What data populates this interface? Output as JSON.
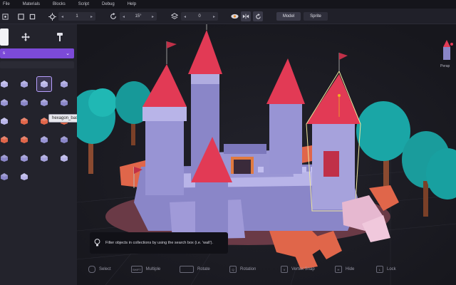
{
  "menu": {
    "items": [
      {
        "label": "File"
      },
      {
        "label": "Materials"
      },
      {
        "label": "Blocks"
      },
      {
        "label": "Script"
      },
      {
        "label": "Debug"
      },
      {
        "label": "Help"
      }
    ]
  },
  "toolbar": {
    "step_value": "1",
    "rotate_value": "15°",
    "layer_value": "0",
    "mode_model": "Model",
    "mode_sprite": "Sprite"
  },
  "sidebar": {
    "collection_label": "s",
    "tooltip": "hexagon_base"
  },
  "hint": {
    "text": "Filter objects in collections by using the search box (i.e. 'wall')."
  },
  "shortcuts": [
    {
      "key": "",
      "label": "Select"
    },
    {
      "key": "SHIFT",
      "label": "Multiple"
    },
    {
      "key": "",
      "label": "Rotate"
    },
    {
      "key": "Q",
      "label": "Rotation"
    },
    {
      "key": "V",
      "label": "Vertex Snap"
    },
    {
      "key": "H",
      "label": "Hide"
    },
    {
      "key": "L",
      "label": "Lock"
    }
  ],
  "preview": {
    "label": "Perap"
  },
  "colors": {
    "accent": "#7c4ad8",
    "mode_active": "#3a3a48",
    "mode_inactive": "#2e2e3a",
    "roof_red": "#e23a55",
    "castle_wall": "#8a86c8",
    "tree_teal": "#1aa6a6",
    "rock_salmon": "#e0664a"
  }
}
